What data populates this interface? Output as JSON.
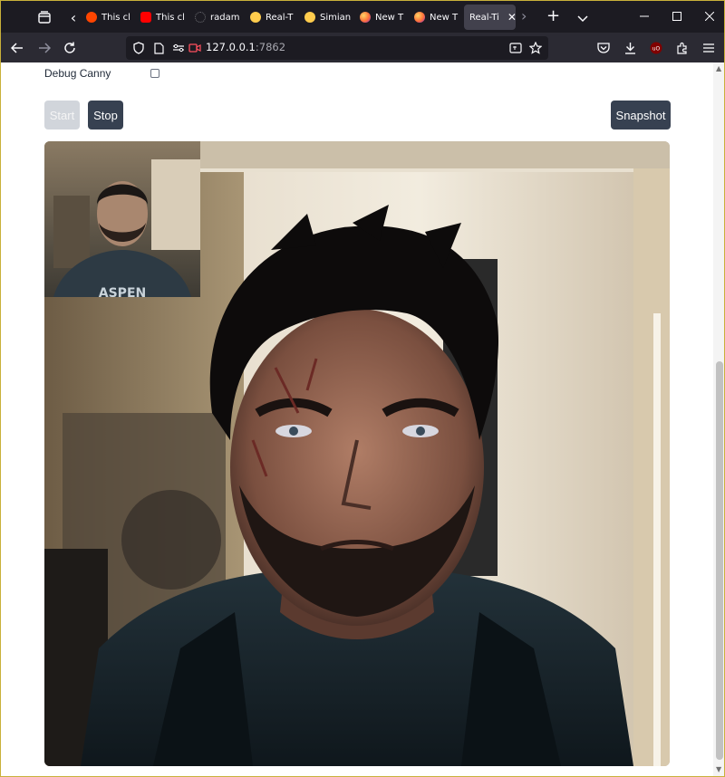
{
  "browser": {
    "tabs": [
      {
        "label": "This cl",
        "favicon": "reddit-icon",
        "color": "#ff4500"
      },
      {
        "label": "This cl",
        "favicon": "youtube-icon",
        "color": "#ff0000"
      },
      {
        "label": "radam",
        "favicon": "github-icon",
        "color": "#6e6e73"
      },
      {
        "label": "Real-T",
        "favicon": "huggingface-icon",
        "color": "#ffcc4d"
      },
      {
        "label": "Simian",
        "favicon": "huggingface-icon",
        "color": "#ffcc4d"
      },
      {
        "label": "New T",
        "favicon": "firefox-icon",
        "color": "#ff7139"
      },
      {
        "label": "New T",
        "favicon": "firefox-icon",
        "color": "#ff7139"
      },
      {
        "label": "Real-Ti",
        "favicon": "none",
        "active": true
      }
    ],
    "url_host": "127.0.0.1",
    "url_port": ":7862"
  },
  "page": {
    "debug_label": "Debug Canny",
    "debug_checked": false,
    "start_label": "Start",
    "stop_label": "Stop",
    "snapshot_label": "Snapshot"
  },
  "colors": {
    "tabstrip_bg": "#1c1b22",
    "navbar_bg": "#2b2a33",
    "button_dark": "#374151",
    "button_disabled": "#d1d5db"
  }
}
